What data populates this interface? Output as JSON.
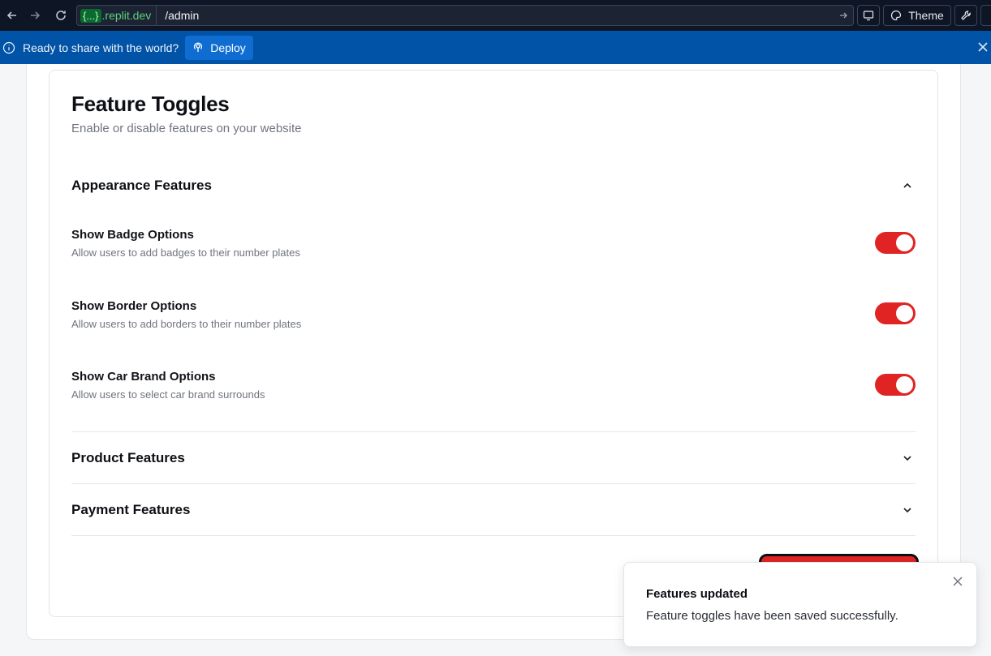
{
  "browser": {
    "domain_braces": "{...}",
    "domain_suffix": ".replit.dev",
    "path": "/admin",
    "theme_label": "Theme"
  },
  "banner": {
    "text": "Ready to share with the world?",
    "deploy_label": "Deploy"
  },
  "page": {
    "title": "Feature Toggles",
    "subtitle": "Enable or disable features on your website"
  },
  "sections": [
    {
      "title": "Appearance Features",
      "expanded": true
    },
    {
      "title": "Product Features",
      "expanded": false
    },
    {
      "title": "Payment Features",
      "expanded": false
    }
  ],
  "features": [
    {
      "name": "Show Badge Options",
      "description": "Allow users to add badges to their number plates",
      "enabled": true
    },
    {
      "name": "Show Border Options",
      "description": "Allow users to add borders to their number plates",
      "enabled": true
    },
    {
      "name": "Show Car Brand Options",
      "description": "Allow users to select car brand surrounds",
      "enabled": true
    }
  ],
  "toast": {
    "title": "Features updated",
    "message": "Feature toggles have been saved successfully."
  },
  "colors": {
    "accent": "#e02424",
    "banner": "#0053a6",
    "toolbar": "#0e1525"
  }
}
